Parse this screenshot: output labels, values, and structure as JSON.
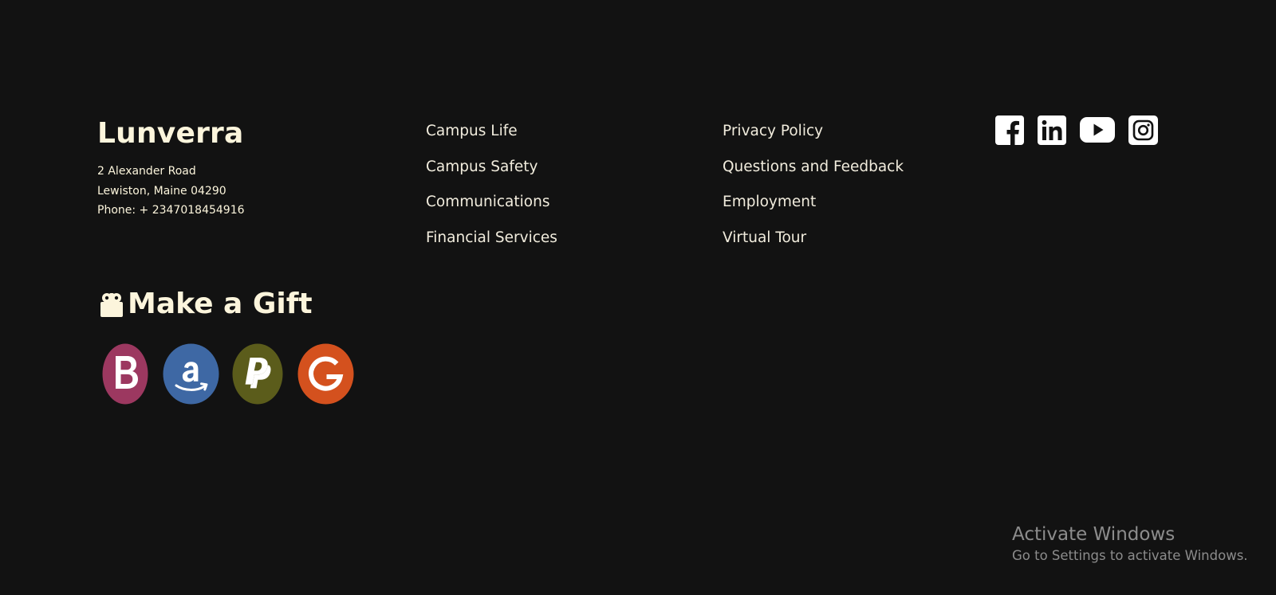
{
  "footer": {
    "brand": "Lunverra",
    "address": {
      "line1": "2 Alexander Road",
      "line2": "Lewiston, Maine 04290",
      "phone": "Phone: + 2347018454916"
    },
    "links_col1": [
      "Campus Life",
      "Campus Safety",
      "Communications",
      "Financial Services"
    ],
    "links_col2": [
      "Privacy Policy",
      "Questions and Feedback",
      "Employment",
      "Virtual Tour"
    ],
    "social": [
      {
        "icon": "facebook-icon"
      },
      {
        "icon": "linkedin-icon"
      },
      {
        "icon": "youtube-icon"
      },
      {
        "icon": "instagram-icon"
      }
    ],
    "gift": {
      "title": "Make a Gift",
      "icon": "gift-icon",
      "payment_methods": [
        {
          "icon": "b-icon",
          "color": "#9c3860"
        },
        {
          "icon": "amazon-icon",
          "color": "#3e68a4"
        },
        {
          "icon": "paypal-icon",
          "color": "#5b5c1b"
        },
        {
          "icon": "google-icon",
          "color": "#d4511e"
        }
      ]
    }
  },
  "system_overlay": {
    "title": "Activate Windows",
    "subtitle": "Go to Settings to activate Windows."
  },
  "colors": {
    "background": "#121212",
    "text": "#fcf5dc",
    "link": "#f1ecdd",
    "watermark": "#8c8c8c"
  }
}
